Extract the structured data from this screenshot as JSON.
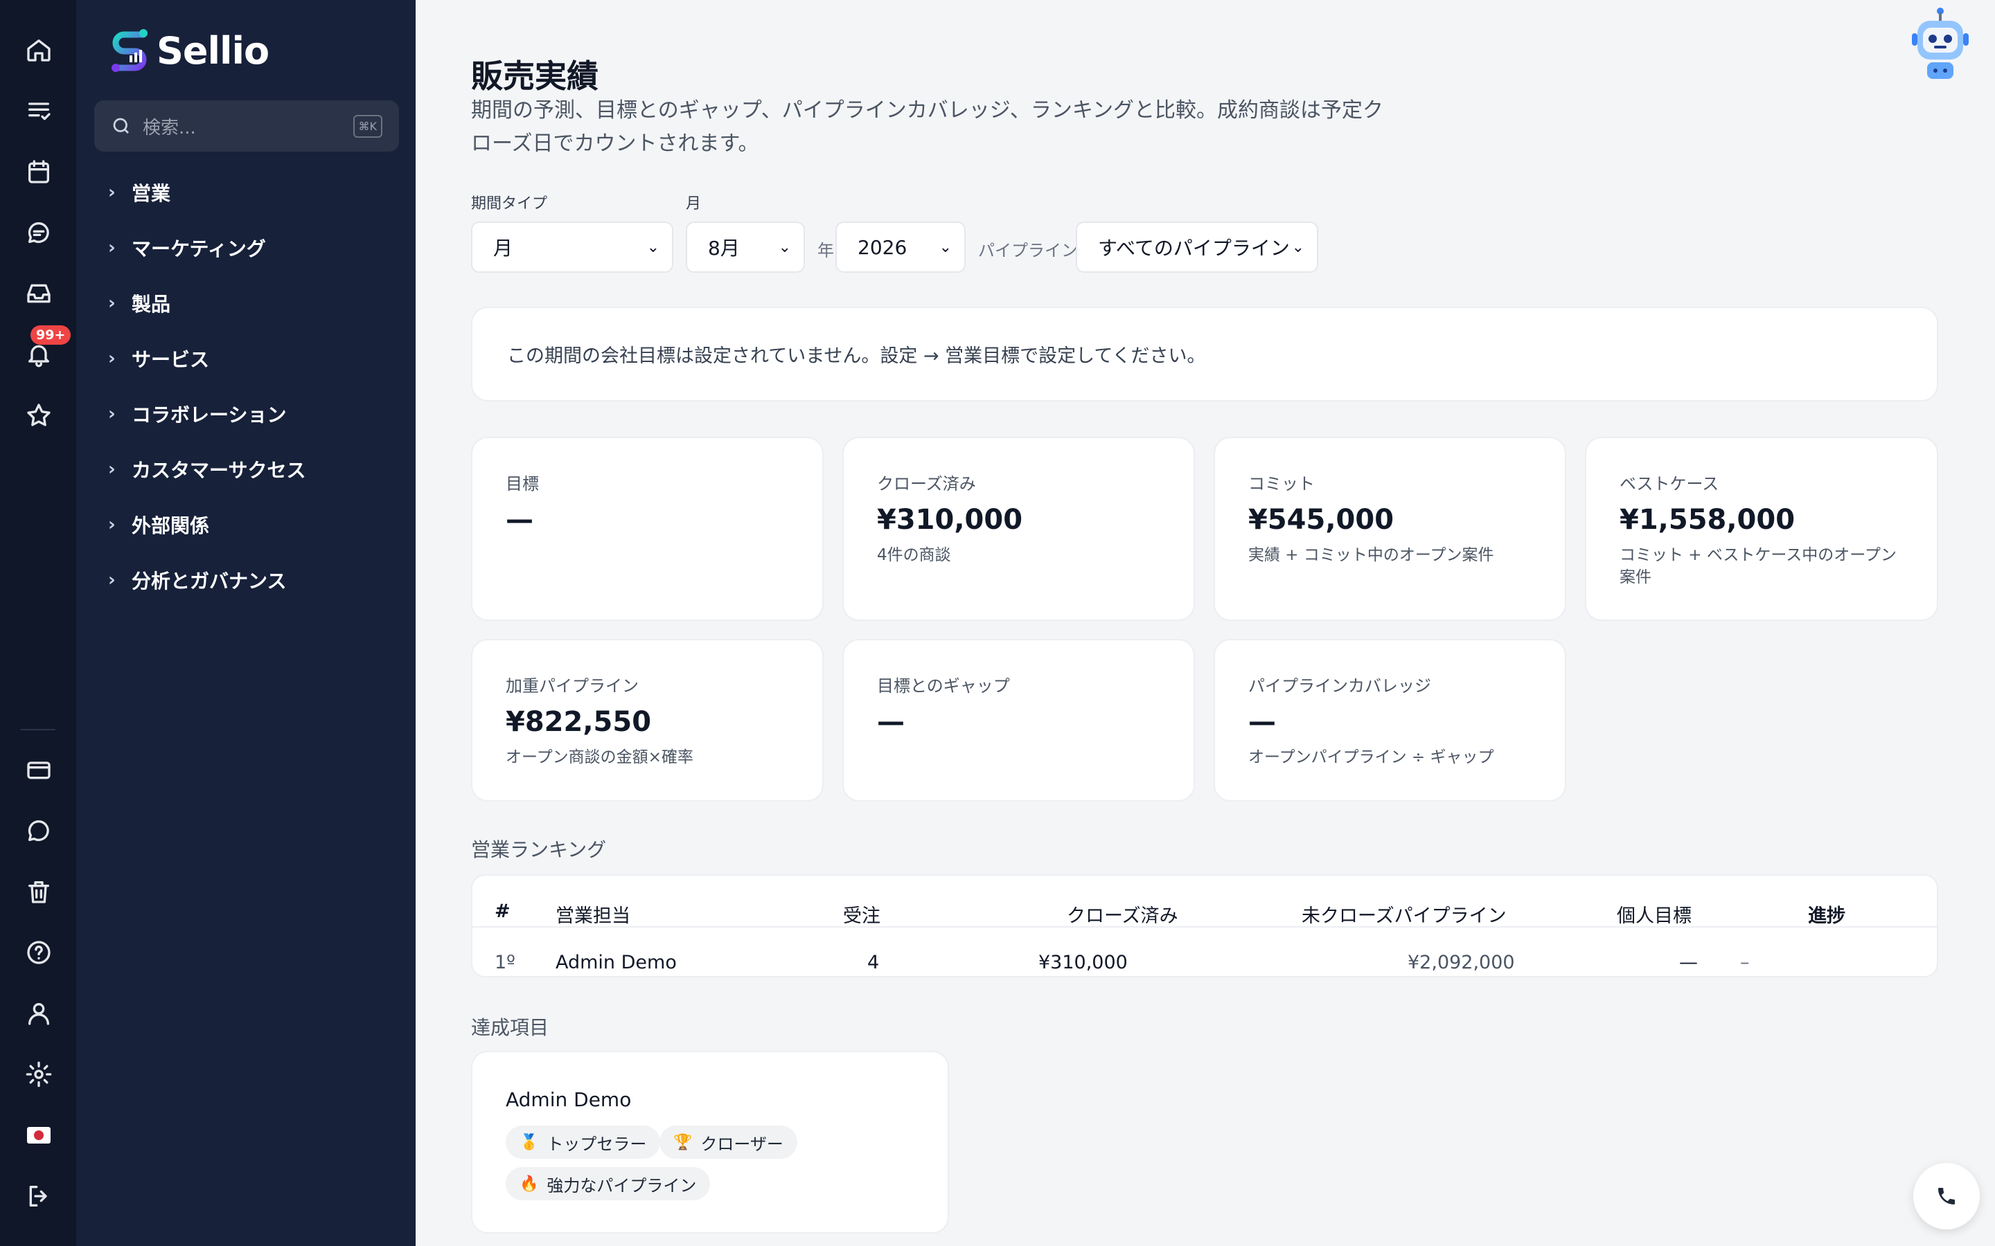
{
  "app": {
    "name": "Sellio",
    "notification_count": "99+"
  },
  "search": {
    "placeholder": "検索...",
    "shortcut": "⌘K"
  },
  "sidebar": {
    "items": [
      {
        "label": "営業"
      },
      {
        "label": "マーケティング"
      },
      {
        "label": "製品"
      },
      {
        "label": "サービス"
      },
      {
        "label": "コラボレーション"
      },
      {
        "label": "カスタマーサクセス"
      },
      {
        "label": "外部関係"
      },
      {
        "label": "分析とガバナンス"
      }
    ]
  },
  "page": {
    "title": "販売実績",
    "subtitle": "期間の予測、目標とのギャップ、パイプラインカバレッジ、ランキングと比較。成約商談は予定クローズ日でカウントされます。"
  },
  "filters": {
    "period_type_label": "期間タイプ",
    "period_type_value": "月",
    "month_label": "月",
    "month_value": "8月",
    "year_label": "年",
    "year_value": "2026",
    "pipeline_label": "パイプライン",
    "pipeline_value": "すべてのパイプライン"
  },
  "notice": "この期間の会社目標は設定されていません。設定 → 営業目標で設定してください。",
  "cards": [
    {
      "label": "目標",
      "value": "—",
      "sub": ""
    },
    {
      "label": "クローズ済み",
      "value": "¥310,000",
      "sub": "4件の商談"
    },
    {
      "label": "コミット",
      "value": "¥545,000",
      "sub": "実績 + コミット中のオープン案件"
    },
    {
      "label": "ベストケース",
      "value": "¥1,558,000",
      "sub": "コミット + ベストケース中のオープン案件"
    },
    {
      "label": "加重パイプライン",
      "value": "¥822,550",
      "sub": "オープン商談の金額×確率"
    },
    {
      "label": "目標とのギャップ",
      "value": "—",
      "sub": ""
    },
    {
      "label": "パイプラインカバレッジ",
      "value": "—",
      "sub": "オープンパイプライン ÷ ギャップ"
    }
  ],
  "ranking": {
    "title": "営業ランキング",
    "headers": [
      "#",
      "営業担当",
      "受注",
      "クローズ済み",
      "未クローズパイプライン",
      "個人目標",
      "進捗"
    ],
    "rows": [
      {
        "rank": "1º",
        "rep": "Admin Demo",
        "won": "4",
        "closed": "¥310,000",
        "open_pipeline": "¥2,092,000",
        "personal_target": "—",
        "progress": "–"
      }
    ]
  },
  "achievements": {
    "title": "達成項目",
    "items": [
      {
        "name": "Admin Demo",
        "badges": [
          {
            "icon": "🥇",
            "label": "トップセラー"
          },
          {
            "icon": "🏆",
            "label": "クローザー"
          },
          {
            "icon": "🔥",
            "label": "強力なパイプライン"
          }
        ]
      }
    ]
  },
  "colors": {
    "rail_bg": "#0f1729",
    "sidebar_bg": "#17213a",
    "badge": "#ef4444",
    "page_bg": "#f4f5f7"
  }
}
